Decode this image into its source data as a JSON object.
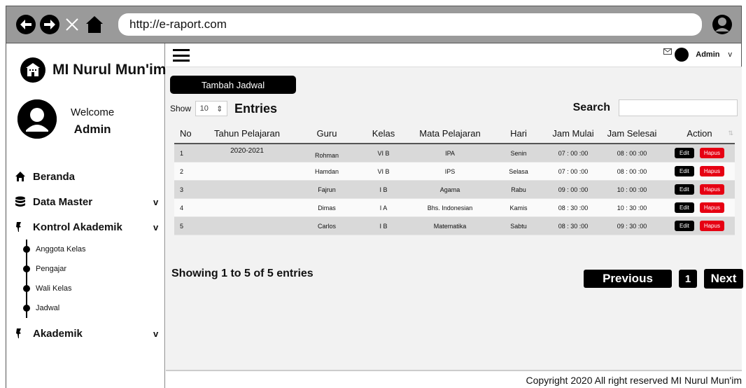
{
  "browser": {
    "url": "http://e-raport.com",
    "icons": [
      "back-icon",
      "forward-icon",
      "close-icon",
      "home-icon",
      "user-icon"
    ]
  },
  "sidebar": {
    "brand": "MI Nurul Mun'im",
    "welcome": "Welcome",
    "user": "Admin",
    "menu": [
      {
        "label": "Beranda",
        "icon": "home-icon",
        "caret": ""
      },
      {
        "label": "Data Master",
        "icon": "database-icon",
        "caret": "v"
      },
      {
        "label": "Kontrol Akademik",
        "icon": "pin-icon",
        "caret": "v"
      },
      {
        "label": "Akademik",
        "icon": "pin-icon",
        "caret": "v"
      }
    ],
    "submenu": [
      "Anggota Kelas",
      "Pengajar",
      "Wali Kelas",
      "Jadwal"
    ]
  },
  "topbar": {
    "user": "Admin",
    "caret": "v",
    "mail_icon": "mail-icon"
  },
  "content": {
    "add_button": "Tambah Jadwal",
    "show_label": "Show",
    "show_value": "10",
    "entries_label": "Entries",
    "search_label": "Search",
    "table": {
      "headers": [
        "No",
        "Tahun Pelajaran",
        "Guru",
        "Kelas",
        "Mata Pelajaran",
        "Hari",
        "Jam Mulai",
        "Jam Selesai",
        "Action"
      ],
      "rows": [
        {
          "no": "1",
          "tahun": "2020-2021",
          "guru": "Rohman",
          "kelas": "VI B",
          "mapel": "IPA",
          "hari": "Senin",
          "mulai": "07 : 00 :00",
          "selesai": "08 : 00 :00"
        },
        {
          "no": "2",
          "tahun": "",
          "guru": "Hamdan",
          "kelas": "VI B",
          "mapel": "IPS",
          "hari": "Selasa",
          "mulai": "07 : 00 :00",
          "selesai": "08 : 00 :00"
        },
        {
          "no": "3",
          "tahun": "",
          "guru": "Fajrun",
          "kelas": "I B",
          "mapel": "Agama",
          "hari": "Rabu",
          "mulai": "09 : 00 :00",
          "selesai": "10 : 00 :00"
        },
        {
          "no": "4",
          "tahun": "",
          "guru": "Dimas",
          "kelas": "I A",
          "mapel": "Bhs. Indonesian",
          "hari": "Kamis",
          "mulai": "08 : 30 :00",
          "selesai": "10 : 30 :00"
        },
        {
          "no": "5",
          "tahun": "",
          "guru": "Carlos",
          "kelas": "I B",
          "mapel": "Matematika",
          "hari": "Sabtu",
          "mulai": "08 : 30 :00",
          "selesai": "09 : 30 :00"
        }
      ],
      "edit_label": "Edit",
      "delete_label": "Hapus"
    },
    "showing": "Showing 1 to 5 of 5 entries",
    "pagination": {
      "previous": "Previous",
      "page": "1",
      "next": "Next"
    }
  },
  "footer": "Copyright 2020 All right reserved MI Nurul Mun'im",
  "colors": {
    "accent": "#000000",
    "danger": "#e60012",
    "chrome": "#9a9a9a"
  }
}
